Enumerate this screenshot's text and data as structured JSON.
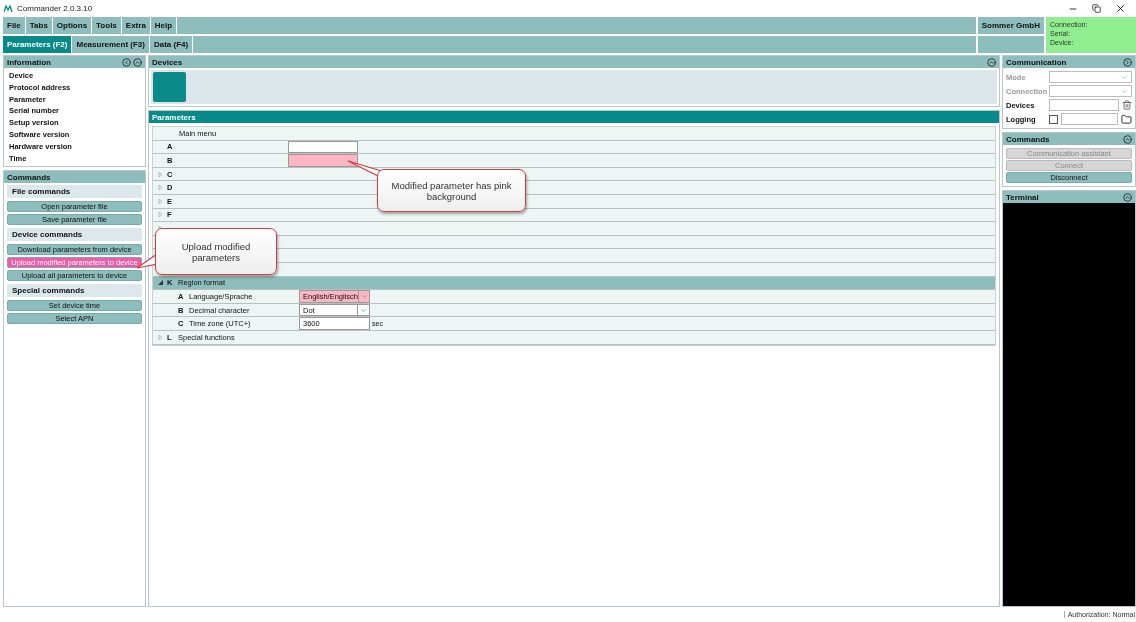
{
  "window": {
    "title": "Commander 2.0.3.10"
  },
  "menu": [
    "File",
    "Tabs",
    "Options",
    "Tools",
    "Extra",
    "Help"
  ],
  "company": "Sommer GmbH",
  "connection_status": [
    "Connection:",
    "Serial:",
    "Device:"
  ],
  "tabs": [
    {
      "label": "Parameters (F2)",
      "selected": true
    },
    {
      "label": "Measurement (F3)",
      "selected": false
    },
    {
      "label": "Data (F4)",
      "selected": false
    }
  ],
  "information": {
    "title": "Information",
    "items": [
      "Device",
      "Protocol address",
      "Parameter",
      "Serial number",
      "Setup version",
      "Software version",
      "Hardware version",
      "Time"
    ]
  },
  "commands": {
    "title": "Commands",
    "sections": [
      {
        "title": "File commands",
        "buttons": [
          {
            "label": "Open parameter file",
            "highlighted": false
          },
          {
            "label": "Save parameter file",
            "highlighted": false
          }
        ]
      },
      {
        "title": "Device commands",
        "buttons": [
          {
            "label": "Download parameters from device",
            "highlighted": false
          },
          {
            "label": "Upload modified parameters to device",
            "highlighted": true
          },
          {
            "label": "Upload all parameters to device",
            "highlighted": false
          }
        ]
      },
      {
        "title": "Special commands",
        "buttons": [
          {
            "label": "Set device time",
            "highlighted": false
          },
          {
            "label": "Select APN",
            "highlighted": false
          }
        ]
      }
    ]
  },
  "devices": {
    "title": "Devices"
  },
  "parameters": {
    "title": "Parameters",
    "header": "Main menu",
    "items": [
      {
        "kind": "field",
        "letter": "A",
        "modified": false
      },
      {
        "kind": "field",
        "letter": "B",
        "modified": true
      },
      {
        "kind": "group",
        "letter": "C",
        "expanded": false
      },
      {
        "kind": "group",
        "letter": "D",
        "expanded": false
      },
      {
        "kind": "group",
        "letter": "E",
        "expanded": false
      },
      {
        "kind": "group",
        "letter": "F",
        "expanded": false
      },
      {
        "kind": "group",
        "expanded": false
      },
      {
        "kind": "blank"
      },
      {
        "kind": "blank"
      },
      {
        "kind": "blank"
      },
      {
        "kind": "group",
        "letter": "K",
        "label": "Region format",
        "expanded": true,
        "children": [
          {
            "kind": "dropdown",
            "letter": "A",
            "label": "Language/Sprache",
            "value": "English/Englisch",
            "modified": true
          },
          {
            "kind": "dropdown",
            "letter": "B",
            "label": "Decimal character",
            "value": "Dot",
            "modified": false
          },
          {
            "kind": "field",
            "letter": "C",
            "label": "Time zone (UTC+)",
            "value": "3600",
            "unit": "sec",
            "modified": false
          }
        ]
      },
      {
        "kind": "group",
        "letter": "L",
        "label": "Special functions",
        "expanded": false
      }
    ]
  },
  "communication": {
    "title": "Communication",
    "rows": [
      {
        "kind": "dropdown",
        "label": "Mode",
        "disabled": true
      },
      {
        "kind": "dropdown",
        "label": "Connection",
        "disabled": true
      },
      {
        "kind": "devices",
        "label": "Devices",
        "disabled": false
      },
      {
        "kind": "logging",
        "label": "Logging",
        "disabled": false,
        "checked": false
      }
    ]
  },
  "comm_commands": {
    "title": "Commands",
    "buttons": [
      {
        "label": "Communication assistant",
        "disabled": true
      },
      {
        "label": "Connect",
        "disabled": true
      },
      {
        "label": "Disconnect",
        "disabled": false
      }
    ]
  },
  "terminal": {
    "title": "Terminal"
  },
  "annotations": [
    {
      "text": "Modified parameter has pink background"
    },
    {
      "text": "Upload modified parameters"
    }
  ],
  "status_bar": "Authorization: Normal"
}
